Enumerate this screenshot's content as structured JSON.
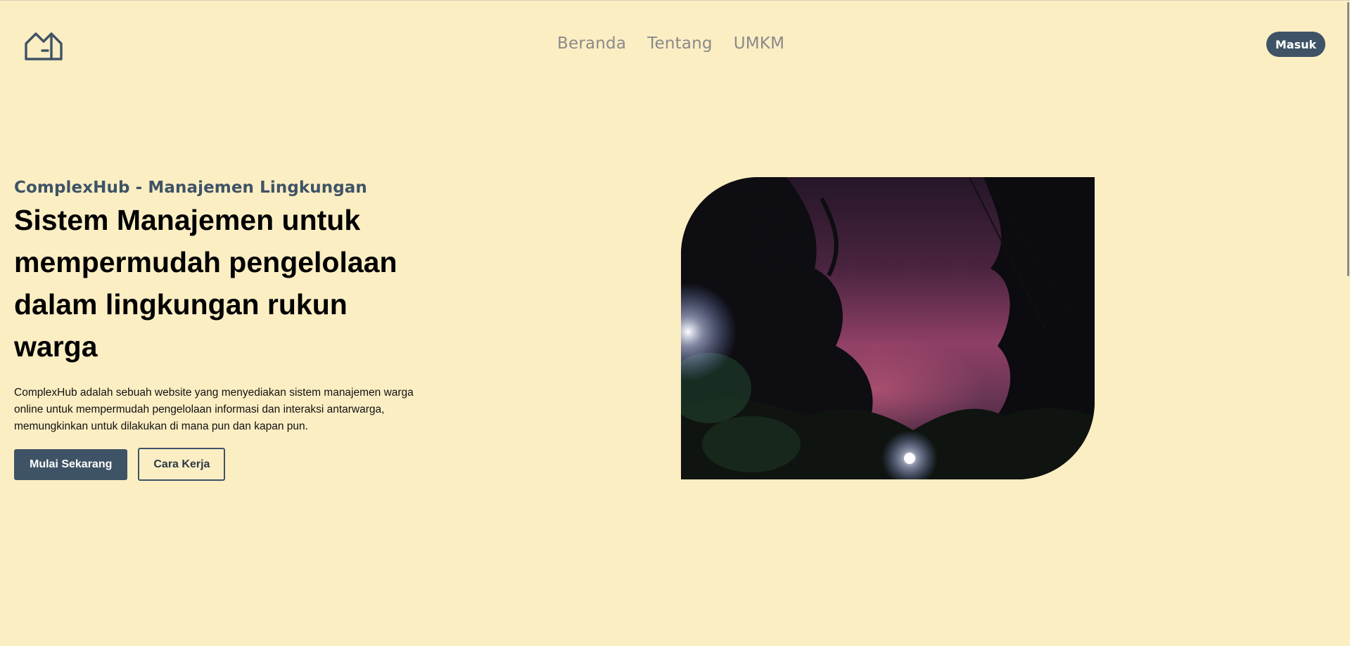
{
  "header": {
    "logo_icon": "house-icon",
    "nav": {
      "home": "Beranda",
      "about": "Tentang",
      "umkm": "UMKM"
    },
    "login_label": "Masuk"
  },
  "hero": {
    "eyebrow": "ComplexHub - Manajemen Lingkungan",
    "headline": "Sistem Manajemen untuk mempermudah pengelolaan dalam lingkungan rukun warga",
    "description": "ComplexHub adalah sebuah website yang menyediakan sistem manajemen warga online untuk mempermudah pengelolaan informasi dan interaksi antarwarga, memungkinkan untuk dilakukan di mana pun dan kapan pun.",
    "primary_cta": "Mulai Sekarang",
    "secondary_cta": "Cara Kerja"
  },
  "colors": {
    "background": "#FCEEC3",
    "accent": "#3E5366",
    "nav_text": "#8A8A8A"
  }
}
